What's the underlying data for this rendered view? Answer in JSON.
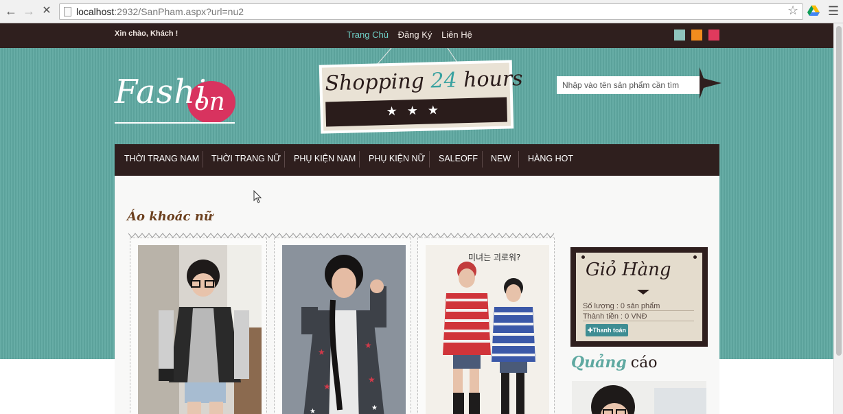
{
  "browser": {
    "url_host": "localhost",
    "url_rest": ":2932/SanPham.aspx?url=nu2"
  },
  "topbar": {
    "greeting": "Xin chào, Khách !",
    "links": [
      {
        "label": "Trang Chủ",
        "active": true
      },
      {
        "label": "Đăng Ký",
        "active": false
      },
      {
        "label": "Liên Hệ",
        "active": false
      }
    ],
    "theme_colors": [
      "#8fc4bd",
      "#f18c1e",
      "#e03a5d"
    ]
  },
  "brand": {
    "logo_text_a": "Fashi",
    "logo_text_b": "on",
    "banner_text": "Shopping",
    "banner_number": "24",
    "banner_text_2": "hours",
    "accent": "#d8335f"
  },
  "search": {
    "placeholder": "Nhập vào tên sản phẩm cần tìm"
  },
  "menu": {
    "items": [
      "THỜI TRANG NAM",
      "THỜI TRANG NỮ",
      "PHỤ KIỆN NAM",
      "PHỤ KIỆN NỮ",
      "SALEOFF",
      "NEW",
      "HÀNG HOT"
    ]
  },
  "category": {
    "title": "Áo khoác nữ",
    "product3_banner": "미녀는 괴로워?"
  },
  "cart": {
    "title": "Giỏ Hàng",
    "quantity_text": "Số lượng : 0 sản phẩm",
    "total_text": "Thành tiền : 0 VNĐ",
    "checkout_label": "✚Thanh toán"
  },
  "ads": {
    "title_a": "Quảng",
    "title_b": "cáo"
  }
}
